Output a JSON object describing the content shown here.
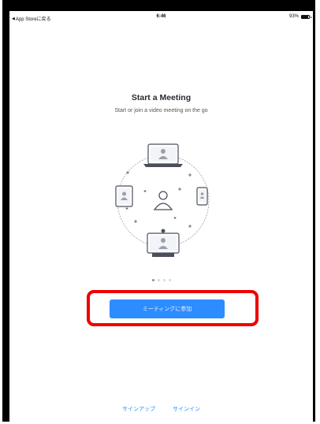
{
  "status_bar": {
    "back_label": "App Storeに戻る",
    "time": "6:46",
    "battery": "93%"
  },
  "main": {
    "title": "Start a Meeting",
    "subtitle": "Start or join a video meeting on the go",
    "page_indicator": {
      "count": 4,
      "active": 0
    },
    "join_button": "ミーティングに参加"
  },
  "footer": {
    "sign_up": "サインアップ",
    "sign_in": "サインイン"
  },
  "colors": {
    "accent": "#2d8cff",
    "highlight": "#ee0000"
  }
}
